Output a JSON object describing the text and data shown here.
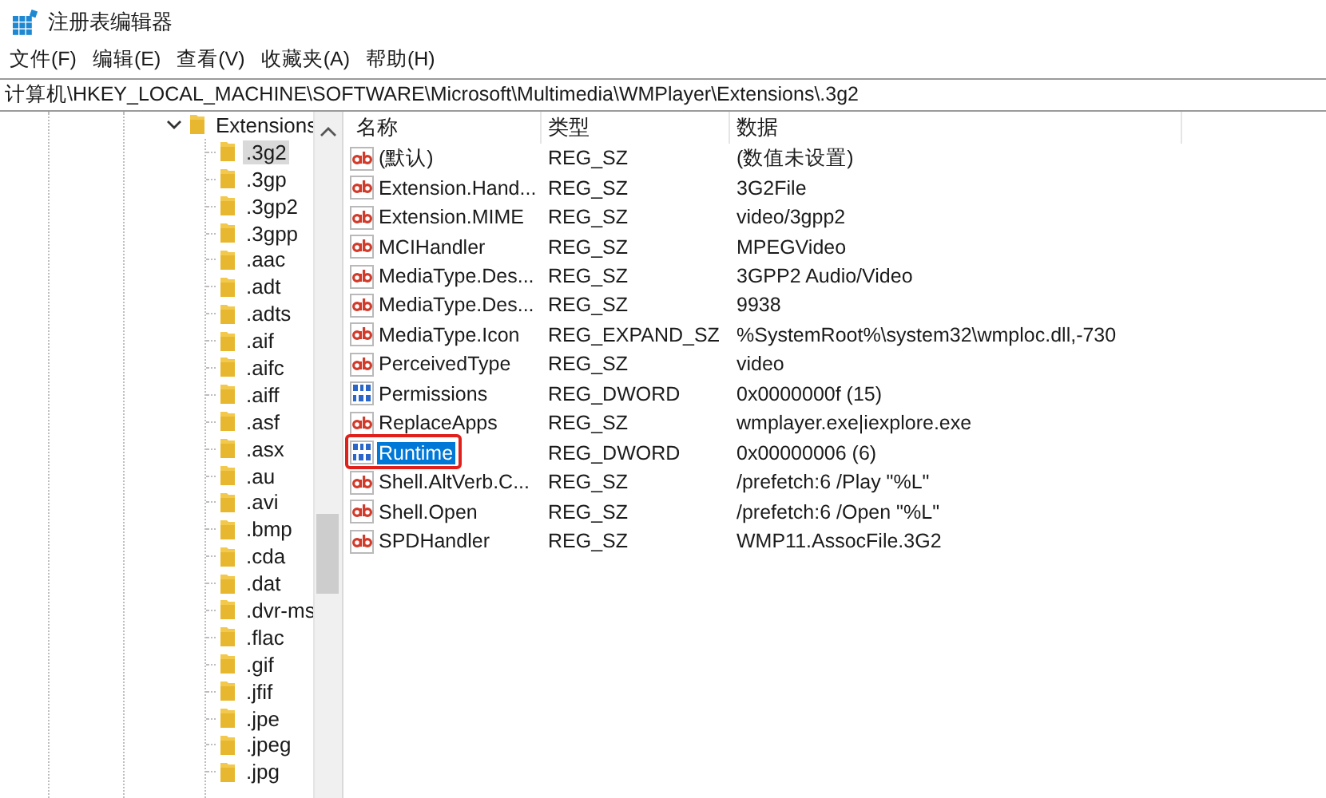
{
  "window": {
    "title": "注册表编辑器"
  },
  "menu": [
    {
      "label": "文件(F)"
    },
    {
      "label": "编辑(E)"
    },
    {
      "label": "查看(V)"
    },
    {
      "label": "收藏夹(A)"
    },
    {
      "label": "帮助(H)"
    }
  ],
  "address": "计算机\\HKEY_LOCAL_MACHINE\\SOFTWARE\\Microsoft\\Multimedia\\WMPlayer\\Extensions\\.3g2",
  "tree": [
    {
      "label": "Extensions",
      "expanded": true,
      "selected": false,
      "children": [
        {
          "label": ".3g2",
          "selected": true
        },
        {
          "label": ".3gp",
          "selected": false
        },
        {
          "label": ".3gp2",
          "selected": false
        },
        {
          "label": ".3gpp",
          "selected": false
        },
        {
          "label": ".aac",
          "selected": false
        },
        {
          "label": ".adt",
          "selected": false
        },
        {
          "label": ".adts",
          "selected": false
        },
        {
          "label": ".aif",
          "selected": false
        },
        {
          "label": ".aifc",
          "selected": false
        },
        {
          "label": ".aiff",
          "selected": false
        },
        {
          "label": ".asf",
          "selected": false
        },
        {
          "label": ".asx",
          "selected": false
        },
        {
          "label": ".au",
          "selected": false
        },
        {
          "label": ".avi",
          "selected": false
        },
        {
          "label": ".bmp",
          "selected": false
        },
        {
          "label": ".cda",
          "selected": false
        },
        {
          "label": ".dat",
          "selected": false
        },
        {
          "label": ".dvr-ms",
          "selected": false
        },
        {
          "label": ".flac",
          "selected": false
        },
        {
          "label": ".gif",
          "selected": false
        },
        {
          "label": ".jfif",
          "selected": false
        },
        {
          "label": ".jpe",
          "selected": false
        },
        {
          "label": ".jpeg",
          "selected": false
        },
        {
          "label": ".jpg",
          "selected": false
        }
      ]
    }
  ],
  "table": {
    "columns": [
      "名称",
      "类型",
      "数据"
    ],
    "rows": [
      {
        "kind": "string",
        "name": "(默认)",
        "type": "REG_SZ",
        "data": "(数值未设置)",
        "selected": false,
        "annotated": false
      },
      {
        "kind": "string",
        "name": "Extension.Hand...",
        "type": "REG_SZ",
        "data": "3G2File",
        "selected": false,
        "annotated": false
      },
      {
        "kind": "string",
        "name": "Extension.MIME",
        "type": "REG_SZ",
        "data": "video/3gpp2",
        "selected": false,
        "annotated": false
      },
      {
        "kind": "string",
        "name": "MCIHandler",
        "type": "REG_SZ",
        "data": "MPEGVideo",
        "selected": false,
        "annotated": false
      },
      {
        "kind": "string",
        "name": "MediaType.Des...",
        "type": "REG_SZ",
        "data": "3GPP2 Audio/Video",
        "selected": false,
        "annotated": false
      },
      {
        "kind": "string",
        "name": "MediaType.Des...",
        "type": "REG_SZ",
        "data": "9938",
        "selected": false,
        "annotated": false
      },
      {
        "kind": "string",
        "name": "MediaType.Icon",
        "type": "REG_EXPAND_SZ",
        "data": "%SystemRoot%\\system32\\wmploc.dll,-730",
        "selected": false,
        "annotated": false
      },
      {
        "kind": "string",
        "name": "PerceivedType",
        "type": "REG_SZ",
        "data": "video",
        "selected": false,
        "annotated": false
      },
      {
        "kind": "binary",
        "name": "Permissions",
        "type": "REG_DWORD",
        "data": "0x0000000f (15)",
        "selected": false,
        "annotated": false
      },
      {
        "kind": "string",
        "name": "ReplaceApps",
        "type": "REG_SZ",
        "data": "wmplayer.exe|iexplore.exe",
        "selected": false,
        "annotated": false
      },
      {
        "kind": "binary",
        "name": "Runtime",
        "type": "REG_DWORD",
        "data": "0x00000006 (6)",
        "selected": true,
        "annotated": true
      },
      {
        "kind": "string",
        "name": "Shell.AltVerb.C...",
        "type": "REG_SZ",
        "data": "/prefetch:6 /Play \"%L\"",
        "selected": false,
        "annotated": false
      },
      {
        "kind": "string",
        "name": "Shell.Open",
        "type": "REG_SZ",
        "data": "/prefetch:6 /Open \"%L\"",
        "selected": false,
        "annotated": false
      },
      {
        "kind": "string",
        "name": "SPDHandler",
        "type": "REG_SZ",
        "data": "WMP11.AssocFile.3G2",
        "selected": false,
        "annotated": false
      }
    ]
  }
}
